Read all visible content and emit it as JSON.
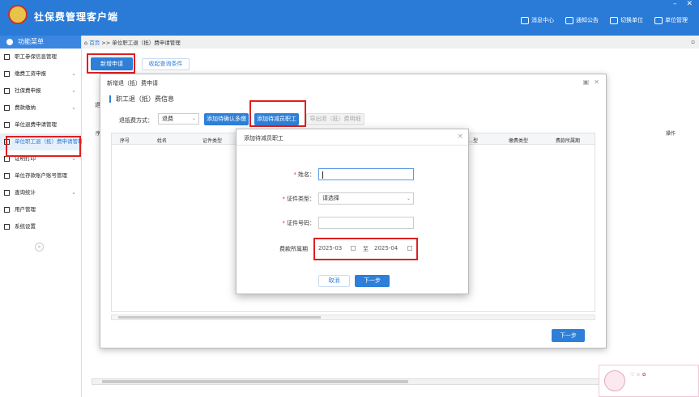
{
  "header": {
    "title": "社保费管理客户端",
    "nav": [
      {
        "icon": "speaker-icon",
        "label": "消息中心"
      },
      {
        "icon": "notice-icon",
        "label": "通知公告"
      },
      {
        "icon": "switch-icon",
        "label": "切换单位"
      },
      {
        "icon": "unit-icon",
        "label": "单位管理"
      }
    ]
  },
  "sidebar": {
    "heading": "功能菜单",
    "items": [
      {
        "label": "职工参保信息管理",
        "chevron": false
      },
      {
        "label": "缴费工资申报",
        "chevron": true
      },
      {
        "label": "社保费申报",
        "chevron": true
      },
      {
        "label": "费款缴纳",
        "chevron": true
      },
      {
        "label": "单位退费申请管理",
        "chevron": false
      },
      {
        "label": "单位职工退（抵）费申请管理",
        "chevron": false
      },
      {
        "label": "证明打印",
        "chevron": true
      },
      {
        "label": "单位存款账户账号管理",
        "chevron": false
      },
      {
        "label": "查询统计",
        "chevron": true
      },
      {
        "label": "用户管理",
        "chevron": false
      },
      {
        "label": "系统设置",
        "chevron": false
      }
    ],
    "collapse_label": "«"
  },
  "breadcrumb": {
    "home": "首页",
    "sep": ">>",
    "current": "单位职工退（抵）费申请管理"
  },
  "toolbar": {
    "new_btn": "新增申请",
    "collapse_btn": "收起查询条件"
  },
  "background": {
    "partial_label": "退",
    "partial_col": "序",
    "col_operation": "操作"
  },
  "modal": {
    "title": "新增退（抵）费申请",
    "section": "职工退（抵）费信息",
    "method_label": "退抵费方式：",
    "method_value": "退费",
    "btn_add_confirm": "添加待确认多缴",
    "btn_add_reduce": "添加待减员职工",
    "btn_export": "导出退（抵）费明细",
    "columns": [
      "序号",
      "姓名",
      "证件类型",
      "…型",
      "缴费类型",
      "费款所属期"
    ],
    "next_btn": "下一步"
  },
  "dialog": {
    "title": "添加待减员职工",
    "name_label": "姓名：",
    "name_value": "",
    "idtype_label": "证件类型：",
    "idtype_value": "请选择",
    "idno_label": "证件号码：",
    "idno_value": "",
    "period_label": "费款所属期",
    "period_start": "2025-03",
    "period_to": "至",
    "period_end": "2025-04",
    "cancel_btn": "取消",
    "next_btn": "下一步"
  },
  "colors": {
    "brand": "#2a7bd7",
    "highlight": "#e01f1f"
  }
}
